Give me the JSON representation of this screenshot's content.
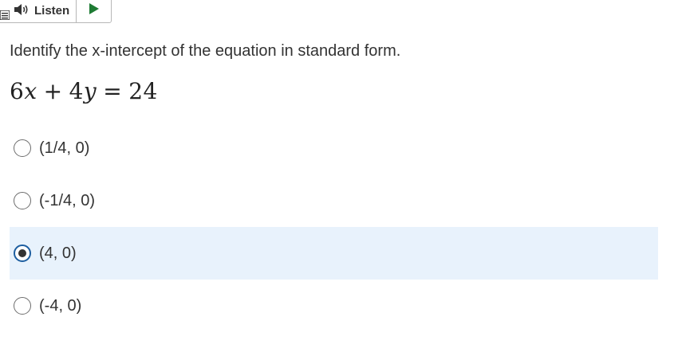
{
  "toolbar": {
    "menu_icon": "menu-icon",
    "speaker_icon": "speaker-icon",
    "listen_label": "Listen",
    "play_icon": "play-icon",
    "accent": "#1e7b34"
  },
  "question": {
    "prompt": "Identify the x-intercept of the equation in standard form.",
    "equation": {
      "coef_x": "6",
      "var_x": "x",
      "plus": "+",
      "coef_y": "4",
      "var_y": "y",
      "equals": "=",
      "rhs": "24"
    }
  },
  "options": [
    {
      "label": "(1/4, 0)",
      "selected": false
    },
    {
      "label": "(-1/4, 0)",
      "selected": false
    },
    {
      "label": "(4, 0)",
      "selected": true
    },
    {
      "label": "(-4, 0)",
      "selected": false
    }
  ],
  "colors": {
    "selected_bg": "#e8f2fc",
    "selected_ring": "#1d5ea0"
  }
}
